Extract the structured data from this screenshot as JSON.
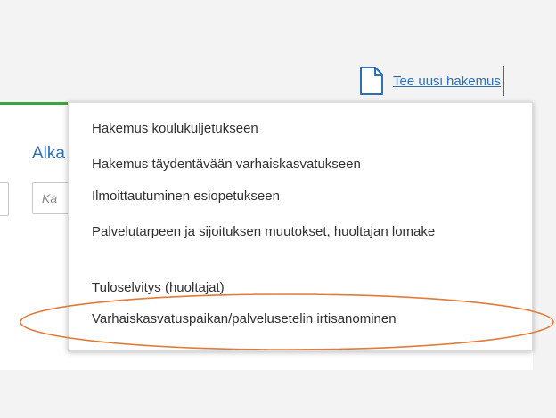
{
  "header": {
    "new_application_label": "Tee uusi hakemus",
    "new_application_icon": "document-icon"
  },
  "panel": {
    "heading": "Alka",
    "search_placeholder": "Ka"
  },
  "menu": {
    "items": [
      {
        "label": "Hakemus koulukuljetukseen"
      },
      {
        "label": "Hakemus täydentävään varhaiskasvatukseen"
      },
      {
        "label": "Ilmoittautuminen esiopetukseen"
      },
      {
        "label": "Palvelutarpeen ja sijoituksen muutokset, huoltajan lomake"
      },
      {
        "label": "Tuloselvitys (huoltajat)"
      },
      {
        "label": "Varhaiskasvatuspaikan/palvelusetelin irtisanominen"
      }
    ]
  },
  "colors": {
    "link": "#2d70b4",
    "accent_green": "#3aa640",
    "highlight_ellipse": "#e07b3a",
    "background": "#f3f3f3"
  }
}
